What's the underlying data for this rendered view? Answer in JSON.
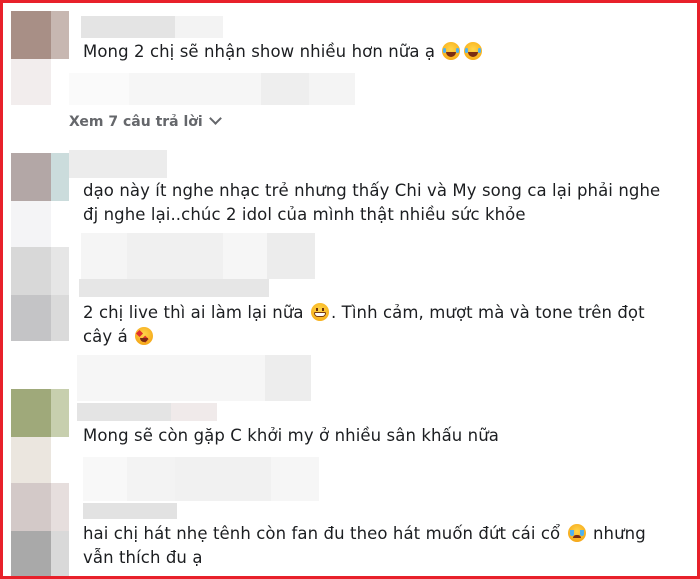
{
  "comments": [
    {
      "line1": "Mong 2 chị sẽ nhận show nhiều hơn nữa ạ",
      "emojis": [
        "laugh-tears-emoji",
        "laugh-tears-emoji"
      ]
    },
    {
      "replies_label": "Xem 7 câu trả lời"
    },
    {
      "line1": "dạo này ít nghe nhạc trẻ nhưng thấy Chi và My song ca lại phải nghe",
      "line2": "đj nghe lại..chúc 2 idol của mình thật nhiều sức khỏe"
    },
    {
      "line1_a": "2 chị live thì ai làm lại nữa",
      "line1_b": ". Tình cảm, mượt mà và tone trên đọt",
      "line2": "cây á",
      "emojis": [
        "grin-emoji",
        "star-struck-emoji"
      ]
    },
    {
      "line1": "Mong sẽ còn gặp C khởi my ở nhiều sân khấu nữa"
    },
    {
      "line1_a": "hai chị hát nhẹ tênh còn fan đu theo hát muốn đứt cái cổ",
      "line1_b": "nhưng",
      "line2": "vẫn thích đu ạ",
      "emojis": [
        "crying-emoji"
      ]
    }
  ],
  "colors": {
    "border": "#e8202a",
    "text": "#1c1e21",
    "muted": "#65676b"
  }
}
